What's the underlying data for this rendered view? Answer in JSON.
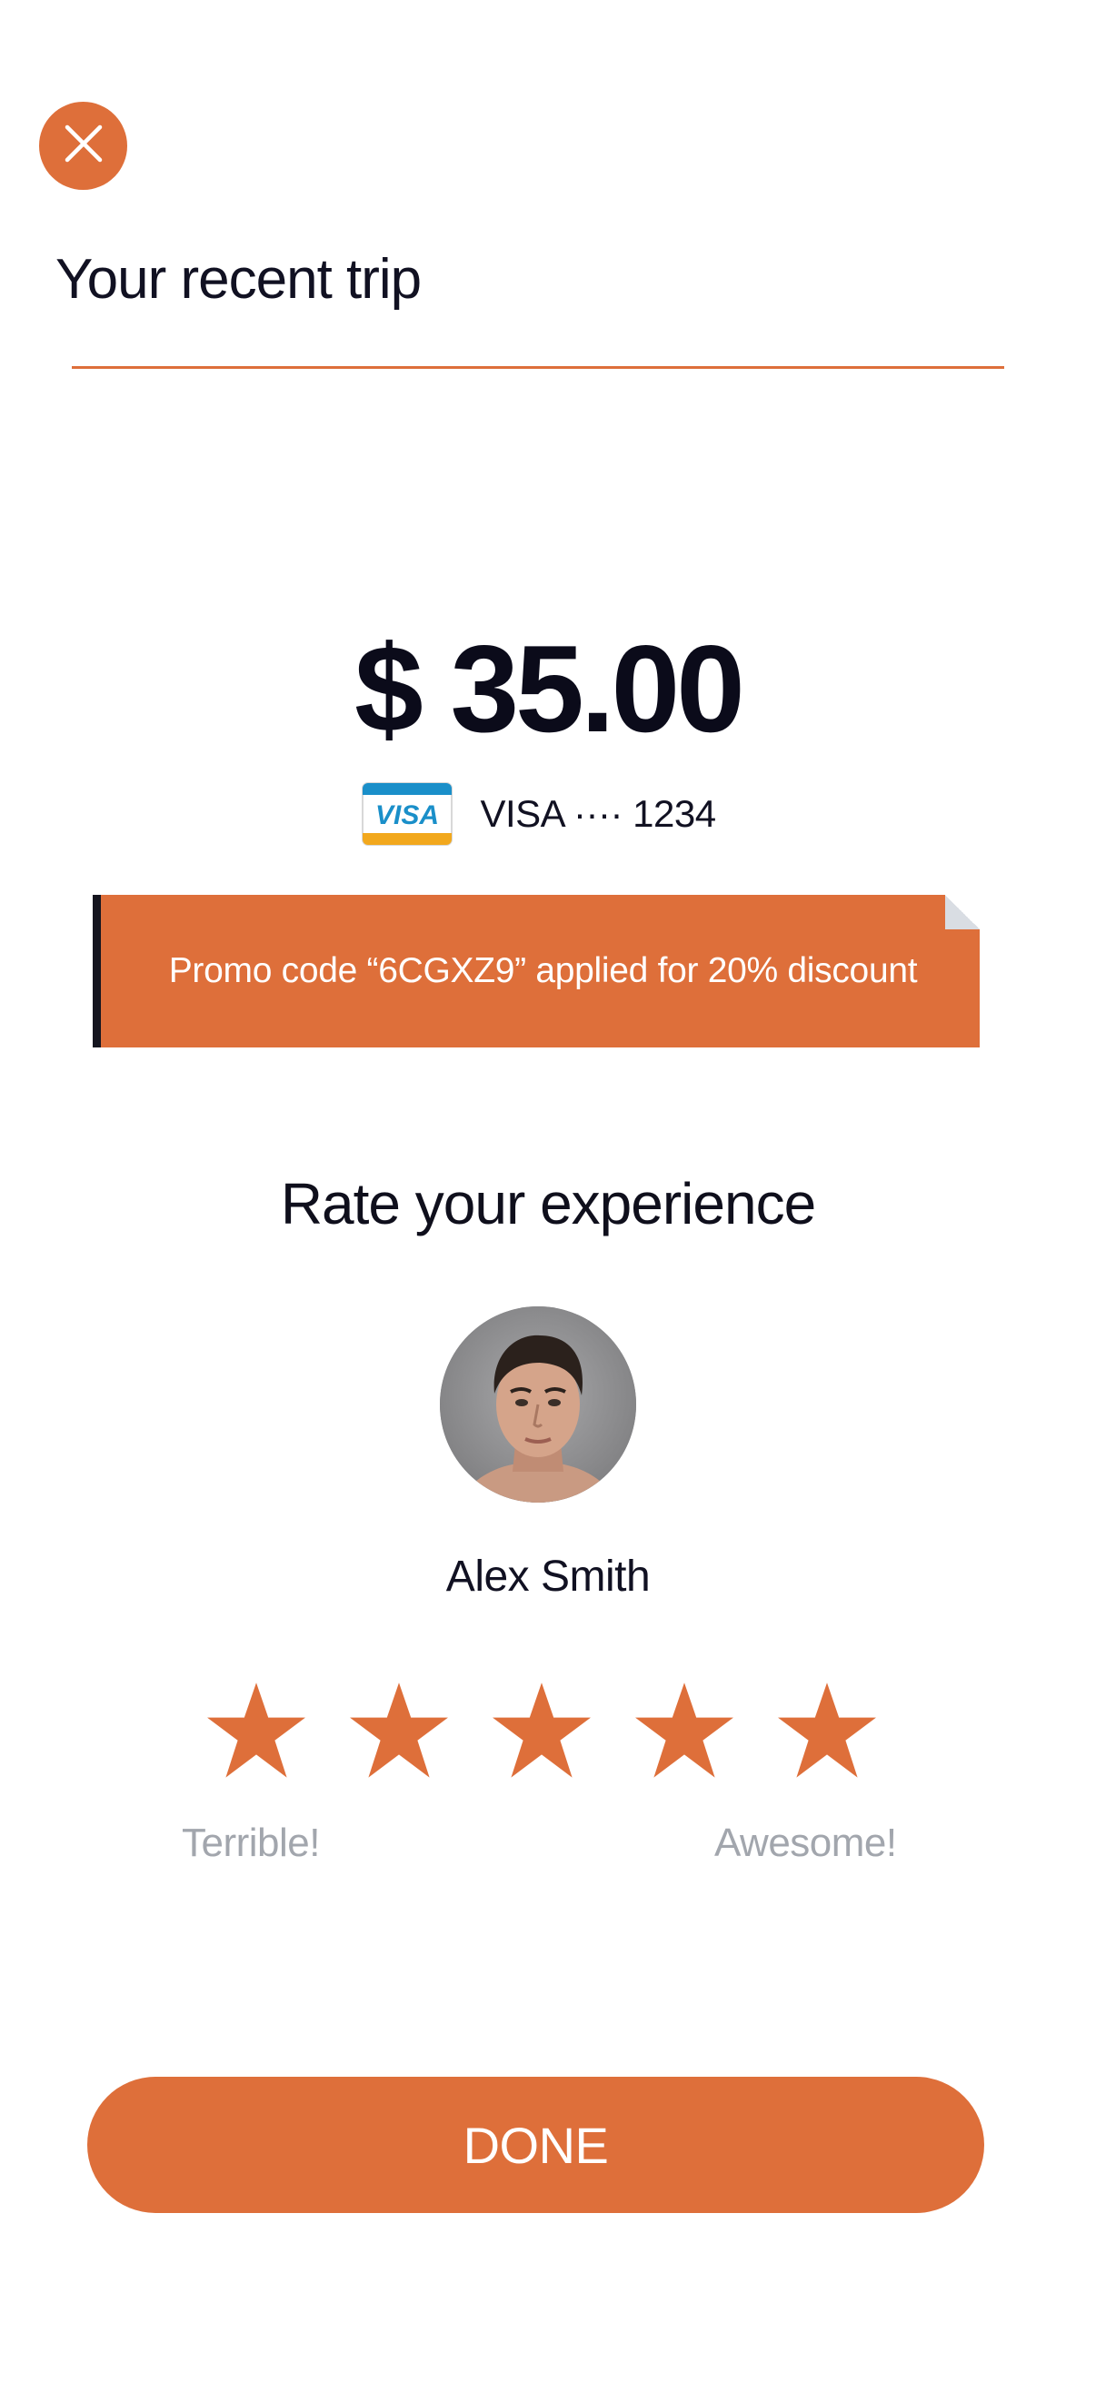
{
  "header": {
    "close_icon": "close-icon",
    "title": "Your recent trip"
  },
  "payment": {
    "amount": "$ 35.00",
    "card_brand_icon": "visa-card-icon",
    "card_label": "VISA ···· 1234"
  },
  "promo": {
    "text": "Promo code “6CGXZ9” applied for 20% discount"
  },
  "rating": {
    "heading": "Rate your experience",
    "driver_name": "Alex Smith",
    "stars_total": 5,
    "low_label": "Terrible!",
    "high_label": "Awesome!"
  },
  "actions": {
    "done_label": "DONE"
  },
  "colors": {
    "accent": "#de6f3a",
    "text_dark": "#0f0f1c",
    "text_muted": "#a2a6ad",
    "promo_stripe": "#15151f"
  }
}
